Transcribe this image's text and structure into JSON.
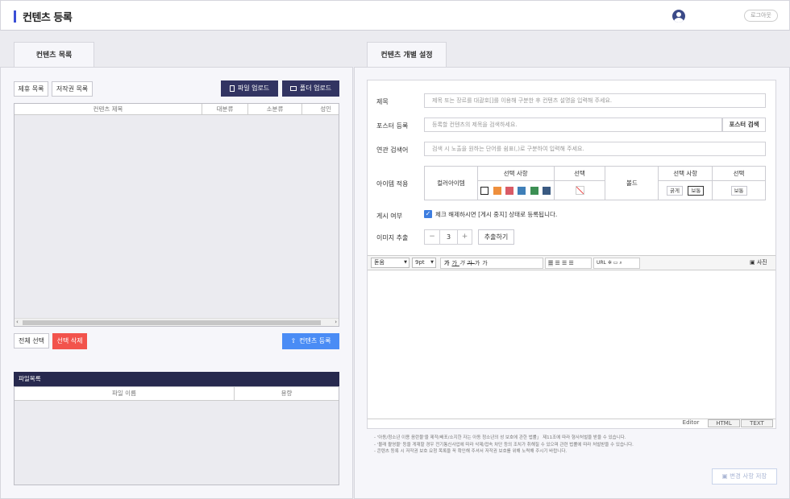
{
  "header": {
    "title": "컨텐츠 등록",
    "logout_label": "로그아웃"
  },
  "left": {
    "tab_label": "컨텐츠 목록",
    "filter_buttons": [
      "제휴 목록",
      "저작권 목록"
    ],
    "upload_file_label": "파일 업로드",
    "upload_folder_label": "폴더 업로드",
    "table_columns": [
      "컨텐츠 제목",
      "대분류",
      "소분류",
      "성인"
    ],
    "select_all_label": "전체 선택",
    "delete_selected_label": "선택 삭제",
    "register_label": "컨텐츠 등록",
    "file_list_title": "파일목록",
    "file_columns": [
      "파일 이름",
      "용량"
    ]
  },
  "right": {
    "tab_label": "컨텐츠 개별 설정",
    "title_label": "제목",
    "title_placeholder": "제목 또는 장르를 대괄호[]를 이용해 구분한 후 컨텐츠 설명을 입력해 주세요.",
    "poster_label": "포스터 등록",
    "poster_placeholder": "등록할 컨텐츠의 제목을 검색하세요.",
    "poster_search_label": "포스터 검색",
    "keyword_label": "연관 검색어",
    "keyword_placeholder": "검색 시 노출을 원하는 단어를 쉼표(,)로 구분하여 입력해 주세요.",
    "item_label": "아이템 적용",
    "item_table": {
      "color_item": "컬러아이템",
      "select_option": "선택 사항",
      "select": "선택",
      "bold": "볼드",
      "bold_select_option": "선택 사항",
      "bold_select": "선택",
      "bold_options": [
        "굵게",
        "보통"
      ],
      "bold_selected": "보통"
    },
    "swatches": [
      "#ee8f3d",
      "#d95b66",
      "#3f7fb8",
      "#3c8f54",
      "#3a5a82"
    ],
    "publish_label": "게시 여부",
    "publish_checked": true,
    "publish_text": "체크 해제하시면 [게시 중지] 상태로 등록됩니다.",
    "extract_label": "이미지 추출",
    "extract_value": "3",
    "extract_button": "추출하기",
    "editor": {
      "font": "돋움",
      "size": "9pt",
      "photo_label": "사진",
      "modes": [
        "Editor",
        "HTML",
        "TEXT"
      ]
    },
    "notes": [
      "- '아동/청소년 이용 음란물'을 제작/배포/소지한 자는 아동 청소년의 성 보호에 관한 법률」 제11조에 따라 형사처벌을 받을 수 있습니다.",
      "- '몰래 촬영물' 등을 게재할 경우 전기통신사업에 따라 삭제/접속 차단 등의 조치가 취해질 수 있으며 관련 법률에 따라 처벌받을 수 있습니다.",
      "- 콘텐츠 등록 시 저작권 보호 요청 목록을 꼭 확인해 주셔서 저작권 보호를 위해 노력해 주시기 바랍니다."
    ],
    "save_label": "변경 사항 저장"
  }
}
